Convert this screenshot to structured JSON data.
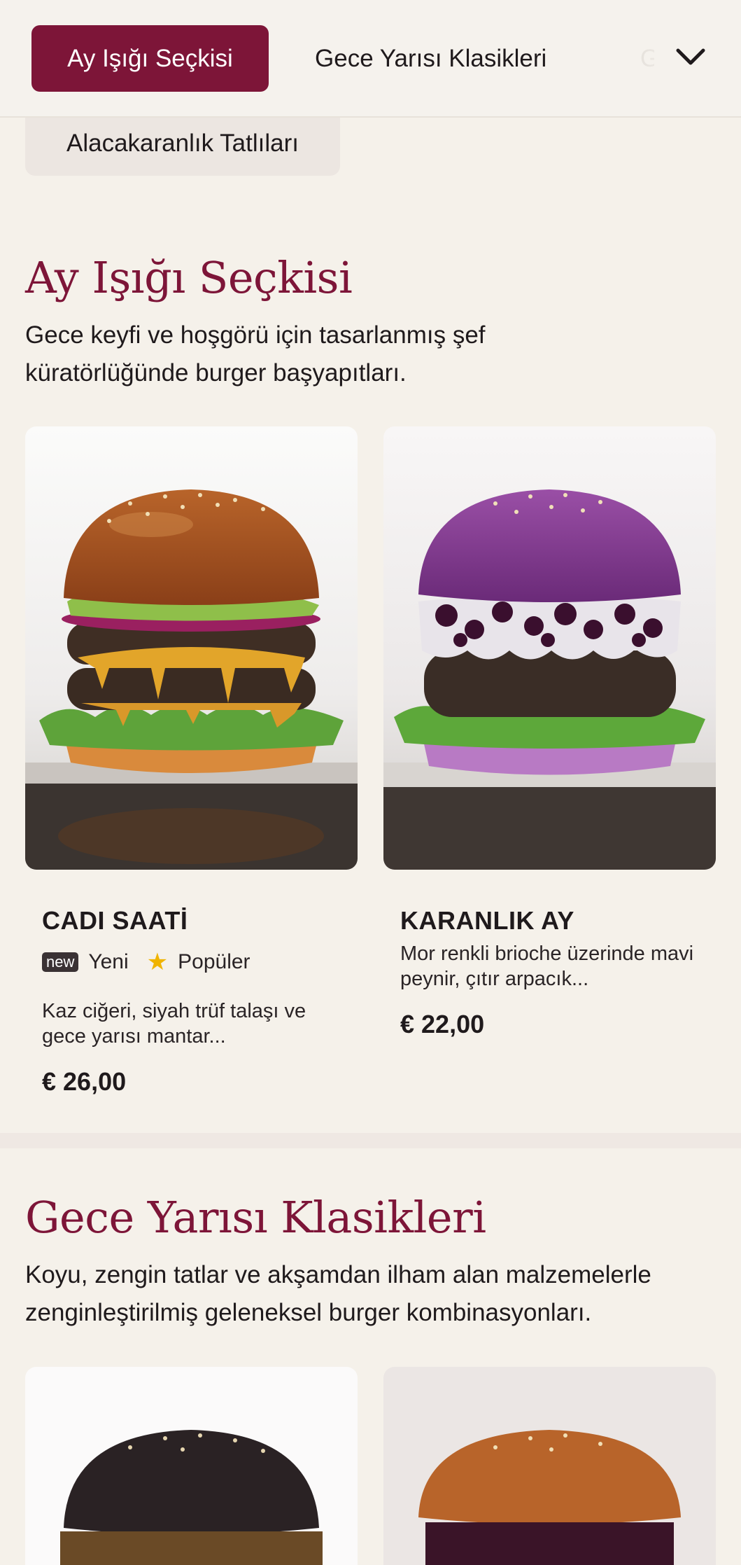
{
  "nav": {
    "tabs": [
      "Ay Işığı Seçkisi",
      "Gece Yarısı Klasikleri",
      "G",
      "Alacakaranlık Tatlıları"
    ],
    "more_icon": "chevron-down-icon",
    "active_color": "#7d1538"
  },
  "sections": [
    {
      "title": "Ay Işığı Seçkisi",
      "description": "Gece keyfi ve hoşgörü için tasarlanmış şef küratörlüğünde burger başyapıtları.",
      "items": [
        {
          "name": "CADI SAATİ",
          "badge_new": "new",
          "badge_new_label": "Yeni",
          "badge_popular_label": "Popüler",
          "description": "Kaz ciğeri, siyah trüf talaşı ve gece yarısı mantar...",
          "price": "€ 26,00"
        },
        {
          "name": "KARANLIK AY",
          "description": "Mor renkli brioche üzerinde mavi peynir, çıtır arpacık...",
          "price": "€ 22,00"
        }
      ]
    },
    {
      "title": "Gece Yarısı Klasikleri",
      "description": "Koyu, zengin tatlar ve akşamdan ilham alan malzemelerle zenginleştirilmiş geleneksel burger kombinasyonları."
    }
  ]
}
